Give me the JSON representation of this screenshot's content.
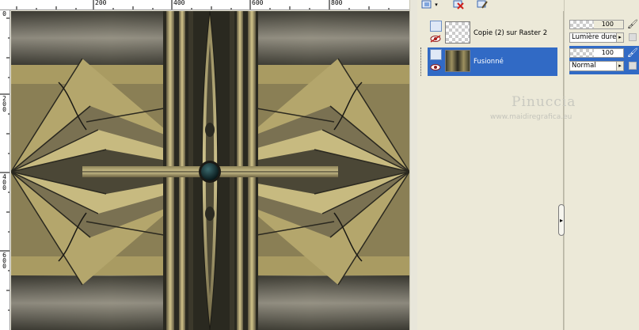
{
  "rulers": {
    "top_labels": [
      "200",
      "400",
      "600",
      "800"
    ],
    "left_labels": [
      "0",
      "200",
      "400",
      "600"
    ]
  },
  "layers_panel": {
    "toolbar_icons": [
      "new-layer-icon",
      "dropdown-icon",
      "delete-layer-icon",
      "edit-icon"
    ],
    "layers": [
      {
        "name": "Copie (2) sur Raster 2",
        "opacity": "100",
        "blend_mode": "Lumière dure",
        "selected": false,
        "visible_icon": "hidden-eye-icon"
      },
      {
        "name": "Fusionné",
        "opacity": "100",
        "blend_mode": "Normal",
        "selected": true,
        "visible_icon": "eye-icon"
      }
    ]
  },
  "watermark": {
    "line1": "Pinuccia",
    "line2": "www.maidiregrafica.eu"
  },
  "colors": {
    "selection": "#316ac5",
    "panel_bg": "#ece9d8",
    "gold": "#b3a46a",
    "dark": "#1e1d18"
  }
}
